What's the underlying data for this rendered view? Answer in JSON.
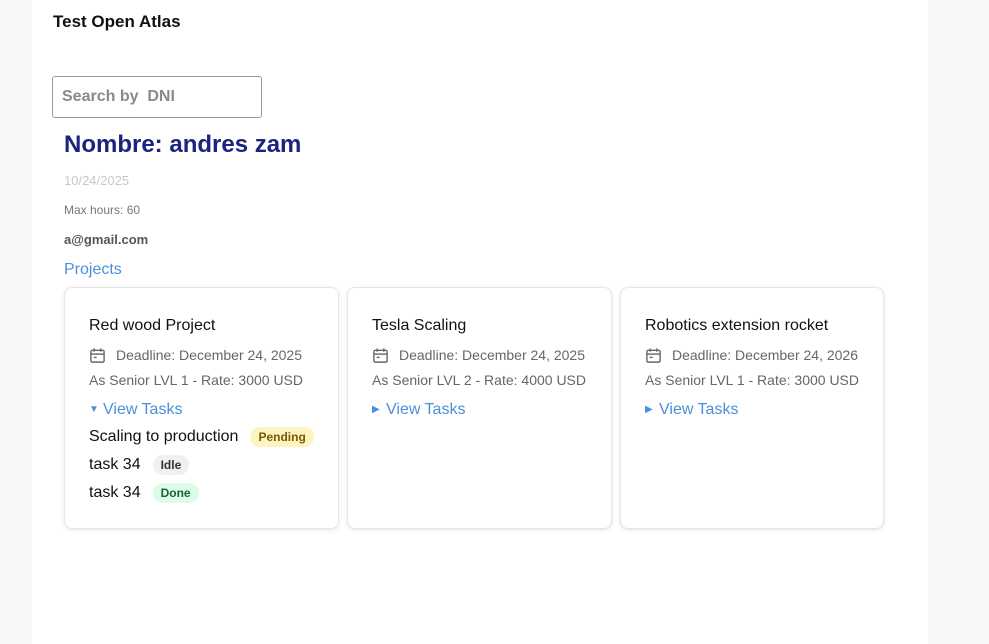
{
  "app": {
    "title": "Test Open Atlas"
  },
  "search": {
    "placeholder": "Search by  DNI",
    "value": ""
  },
  "user": {
    "name": "Nombre: andres zam",
    "date": "10/24/2025",
    "max_hours": "Max hours: 60",
    "email": "a@gmail.com"
  },
  "projects_heading": "Projects",
  "projects": [
    {
      "name": "Red wood Project",
      "deadline": "Deadline: December 24, 2025",
      "rate": "As Senior LVL 1 - Rate: 3000 USD",
      "view_tasks_label": "View Tasks",
      "expanded": true,
      "tasks": [
        {
          "name": "Scaling to production",
          "status": "Pending"
        },
        {
          "name": "task 34",
          "status": "Idle"
        },
        {
          "name": "task 34",
          "status": "Done"
        }
      ]
    },
    {
      "name": "Tesla Scaling",
      "deadline": "Deadline: December 24, 2025",
      "rate": "As Senior LVL 2 - Rate: 4000 USD",
      "view_tasks_label": "View Tasks",
      "expanded": false,
      "tasks": []
    },
    {
      "name": "Robotics extension rocket",
      "deadline": "Deadline: December 24, 2026",
      "rate": "As Senior LVL 1 - Rate: 3000 USD",
      "view_tasks_label": "View Tasks",
      "expanded": false,
      "tasks": []
    }
  ],
  "icons": {
    "deadline": "calendar-icon",
    "collapsed": "caret-right-icon",
    "expanded": "caret-down-icon"
  },
  "colors": {
    "title_navy": "#1a237e",
    "link_blue": "#4a90d9",
    "pending_bg": "#fdf4c1",
    "idle_bg": "#eef0f3",
    "done_bg": "#dcfce7"
  }
}
